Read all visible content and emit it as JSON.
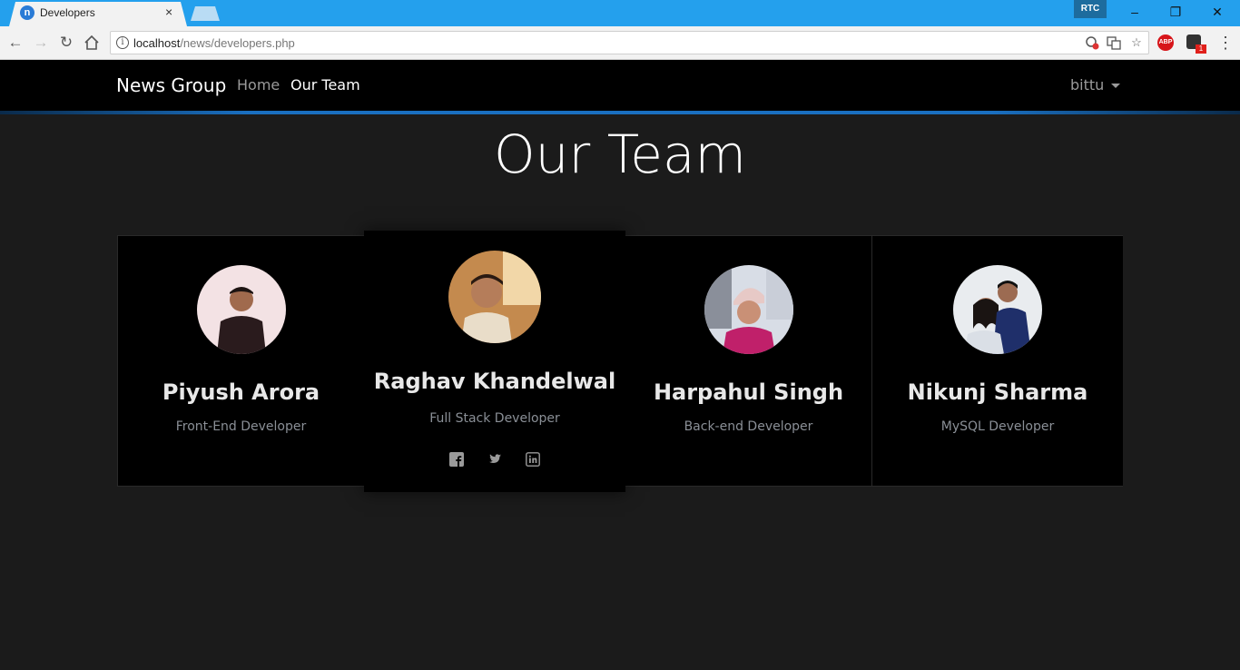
{
  "browser": {
    "tab_title": "Developers",
    "tab_close": "×",
    "url_host": "localhost",
    "url_path": "/news/developers.php",
    "rtc_badge": "RTC",
    "ext_abp_label": "ABP",
    "ext_badge_count": "1",
    "window_controls": {
      "minimize": "–",
      "restore": "❐",
      "close": "✕"
    }
  },
  "nav": {
    "brand": "News Group",
    "links": [
      {
        "label": "Home",
        "active": false
      },
      {
        "label": "Our Team",
        "active": true
      }
    ],
    "user": "bittu"
  },
  "page": {
    "title": "Our Team"
  },
  "team": [
    {
      "name": "Piyush Arora",
      "role": "Front-End Developer",
      "featured": false
    },
    {
      "name": "Raghav Khandelwal",
      "role": "Full Stack Developer",
      "featured": true,
      "socials": [
        "facebook-icon",
        "twitter-icon",
        "linkedin-icon"
      ]
    },
    {
      "name": "Harpahul Singh",
      "role": "Back-end Developer",
      "featured": false
    },
    {
      "name": "Nikunj Sharma",
      "role": "MySQL Developer",
      "featured": false
    }
  ],
  "colors": {
    "page_bg": "#1b1b1b",
    "navbar_bg": "#000000",
    "accent_line": "#1a6fc0",
    "titlebar": "#24a0ed"
  }
}
